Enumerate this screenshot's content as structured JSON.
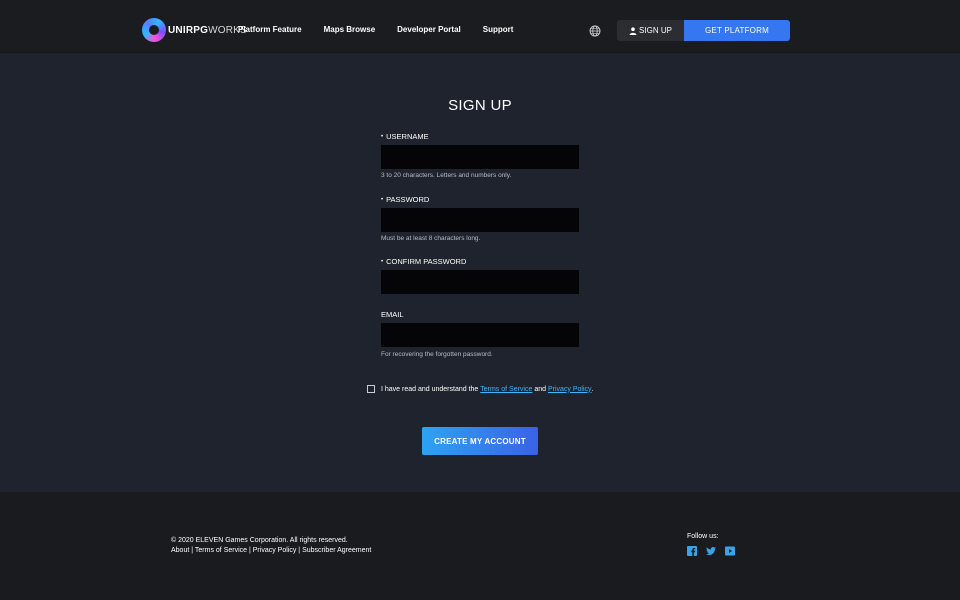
{
  "header": {
    "logo": {
      "bold": "UNIRPG",
      "light": "WORKS"
    },
    "nav": [
      "Platform Feature",
      "Maps Browse",
      "Developer Portal",
      "Support"
    ],
    "signup_label": "SIGN UP",
    "platform_label": "GET PLATFORM"
  },
  "form": {
    "title": "SIGN UP",
    "username": {
      "label": "USERNAME",
      "value": "",
      "hint": "3 to 20 characters. Letters and numbers only."
    },
    "password": {
      "label": "PASSWORD",
      "value": "",
      "hint": "Must be at least 8 characters long."
    },
    "confirm": {
      "label": "CONFIRM PASSWORD",
      "value": ""
    },
    "email": {
      "label": "EMAIL",
      "value": "",
      "hint": "For recovering the forgotten password."
    },
    "required_marker": "•",
    "terms": {
      "prefix": "I have read and understand the",
      "tos": "Terms of Service",
      "and": "and",
      "privacy": "Privacy Policy",
      "suffix": "."
    },
    "submit_label": "CREATE MY ACCOUNT"
  },
  "footer": {
    "copyright": "© 2020 ELEVEN Games Corporation. All rights reserved.",
    "links": [
      "About",
      "Terms of Service",
      "Privacy Policy",
      "Subscriber Agreement"
    ],
    "separator": "|",
    "follow": "Follow us:",
    "socials": [
      "facebook-icon",
      "twitter-icon",
      "youtube-icon"
    ]
  },
  "colors": {
    "accent": "#3477f0",
    "link": "#3bb7ff",
    "background": "#1f232d",
    "header": "#1b1c20"
  }
}
